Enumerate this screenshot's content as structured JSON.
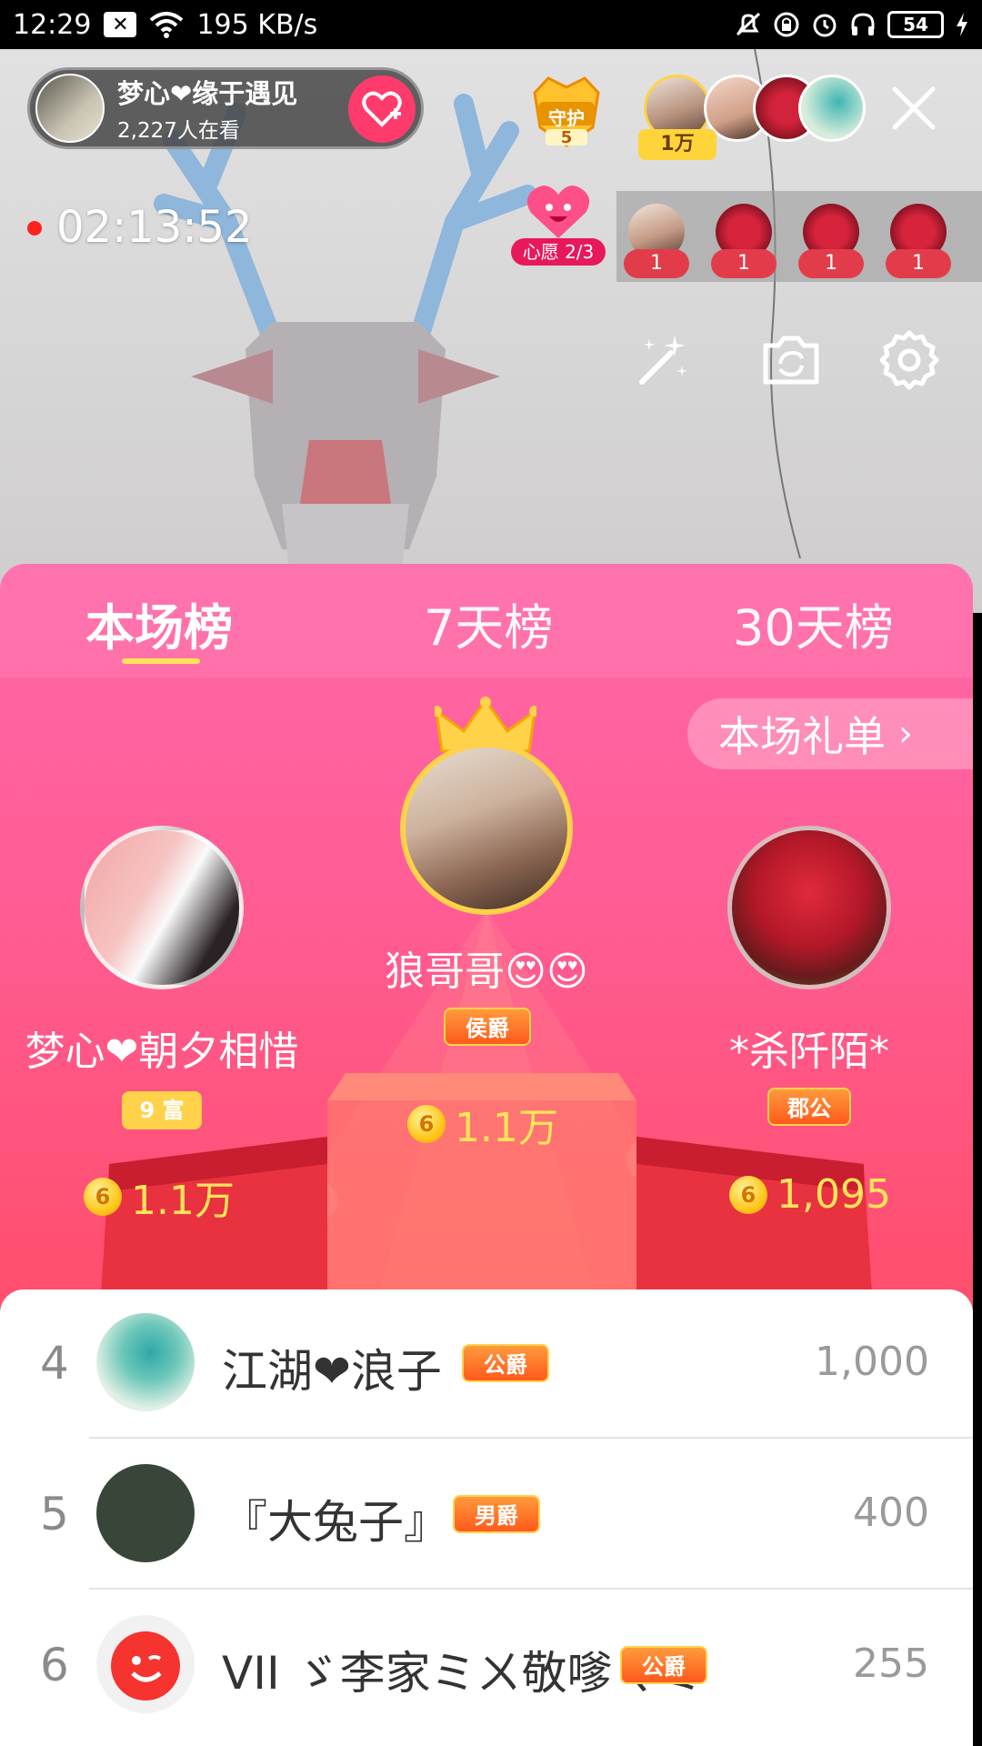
{
  "status_bar": {
    "time": "12:29",
    "notification_icon": "x-box-icon",
    "network_speed": "195 KB/s",
    "battery": "54"
  },
  "live": {
    "host_name": "梦心❤缘于遇见",
    "viewers": "2,227人在看",
    "guard_label": "守护",
    "guard_count": "5",
    "top_tag": "1万",
    "timer": "02:13:52",
    "wish_label": "心愿 2/3",
    "wish_counts": [
      "1",
      "1",
      "1",
      "1"
    ]
  },
  "tabs": [
    "本场榜",
    "7天榜",
    "30天榜"
  ],
  "gift_list_label": "本场礼单",
  "podium": {
    "first": {
      "name": "狼哥哥😍😍",
      "badge": "侯爵",
      "value": "1.1万"
    },
    "second": {
      "name": "梦心❤朝夕相惜",
      "badge": "9 富",
      "value": "1.1万"
    },
    "third": {
      "name": "*杀阡陌*",
      "badge": "郡公",
      "value": "1,095"
    },
    "coin_symbol": "6"
  },
  "list": [
    {
      "rank": "4",
      "name": "江湖❤浪子",
      "badge": "公爵",
      "score": "1,000"
    },
    {
      "rank": "5",
      "name": "『大兔子』",
      "badge": "男爵",
      "score": "400"
    },
    {
      "rank": "6",
      "name": "VII ゞ李家ミㄨ敬嗲ㄑミ",
      "badge": "公爵",
      "score": "255"
    }
  ],
  "colors": {
    "panel_top": "#ff68a9",
    "panel_bottom": "#fd4e58",
    "accent_yellow": "#ffe45a",
    "follow_pink": "#ff3b6b"
  }
}
